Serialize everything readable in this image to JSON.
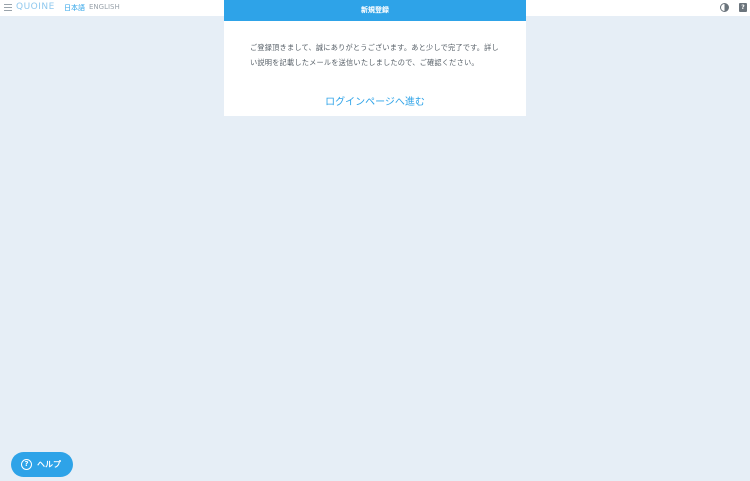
{
  "topbar": {
    "logo": "QUOINE",
    "lang_ja": "日本語",
    "lang_en": "ENGLISH",
    "menu_icon": "hamburger-menu-icon",
    "theme_icon": "half-circle-contrast-icon",
    "help_icon": "question-square-icon",
    "help_icon_glyph": "?"
  },
  "dialog": {
    "title": "新規登録",
    "message": "ご登録頂きまして、誠にありがとうございます。あと少しで完了です。詳しい説明を記載したメールを送信いたしましたので、ご確認ください。",
    "link_label": "ログインページへ進む"
  },
  "help_button": {
    "label": "ヘルプ",
    "icon_glyph": "?"
  },
  "colors": {
    "accent": "#2ea3e8",
    "background": "#e6eef6",
    "text": "#555e66"
  }
}
